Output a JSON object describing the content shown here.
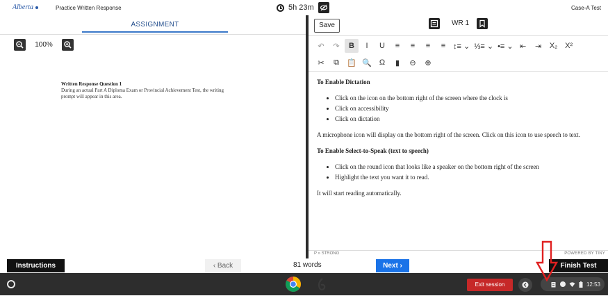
{
  "topbar": {
    "logo_text": "Alberta",
    "app_title": "Practice Written Response",
    "time_remaining": "5h 23m",
    "test_name": "Case-A Test"
  },
  "left_pane": {
    "tab_label": "ASSIGNMENT",
    "zoom_level": "100%",
    "prompt_title": "Written Response Question 1",
    "prompt_text": "During an actual Part A Diploma Exam or Provincial Achievement Test, the writing prompt will appear in this area."
  },
  "editor": {
    "save_label": "Save",
    "wr_label": "WR 1",
    "toolbar_row1": [
      {
        "name": "undo-button",
        "glyph": "↶",
        "dim": true
      },
      {
        "name": "redo-button",
        "glyph": "↷",
        "dim": true
      },
      {
        "name": "bold-button",
        "glyph": "B",
        "active": true
      },
      {
        "name": "italic-button",
        "glyph": "I"
      },
      {
        "name": "underline-button",
        "glyph": "U"
      },
      {
        "name": "align-left-button",
        "glyph": "≡"
      },
      {
        "name": "align-center-button",
        "glyph": "≡"
      },
      {
        "name": "align-right-button",
        "glyph": "≡"
      },
      {
        "name": "justify-button",
        "glyph": "≡"
      },
      {
        "name": "line-height-button",
        "glyph": "↕≡ ⌄"
      },
      {
        "name": "numbered-list-button",
        "glyph": "⅓≡ ⌄"
      },
      {
        "name": "bullet-list-button",
        "glyph": "•≡ ⌄"
      },
      {
        "name": "outdent-button",
        "glyph": "⇤"
      },
      {
        "name": "indent-button",
        "glyph": "⇥"
      },
      {
        "name": "subscript-button",
        "glyph": "X₂"
      },
      {
        "name": "superscript-button",
        "glyph": "X²"
      }
    ],
    "toolbar_row2": [
      {
        "name": "cut-button",
        "glyph": "✂"
      },
      {
        "name": "copy-button",
        "glyph": "⧉"
      },
      {
        "name": "paste-button",
        "glyph": "📋"
      },
      {
        "name": "find-button",
        "glyph": "🔍"
      },
      {
        "name": "special-char-button",
        "glyph": "Ω"
      },
      {
        "name": "spellcheck-button",
        "glyph": "▮"
      },
      {
        "name": "zoom-out-editor-button",
        "glyph": "⊖"
      },
      {
        "name": "zoom-in-editor-button",
        "glyph": "⊕"
      }
    ],
    "heading1": "To Enable Dictation",
    "list1": [
      "Click on the icon on the bottom right of the screen where the clock is",
      "Click on accessibility",
      "Click on dictation"
    ],
    "paragraph1": "A microphone icon will display on the bottom right of the screen. Click on this icon to use speech to text.",
    "heading2": "To Enable Select-to-Speak (text to speech)",
    "list2": [
      "Click on the round icon that looks like a speaker on the bottom right of the screen",
      "Highlight the text you want it to read."
    ],
    "paragraph2": "It will start reading automatically.",
    "status_path": "P » STRONG",
    "powered_by": "POWERED BY TINY"
  },
  "nav": {
    "instructions_label": "Instructions",
    "back_label": "‹ Back",
    "word_count": "81 words",
    "next_label": "Next ›",
    "finish_label": "Finish Test"
  },
  "shelf": {
    "exit_label": "Exit session",
    "clock": "12:53"
  },
  "colors": {
    "accent_blue": "#1a73e8",
    "exit_red": "#c62828",
    "annotation_red": "#e02020"
  }
}
